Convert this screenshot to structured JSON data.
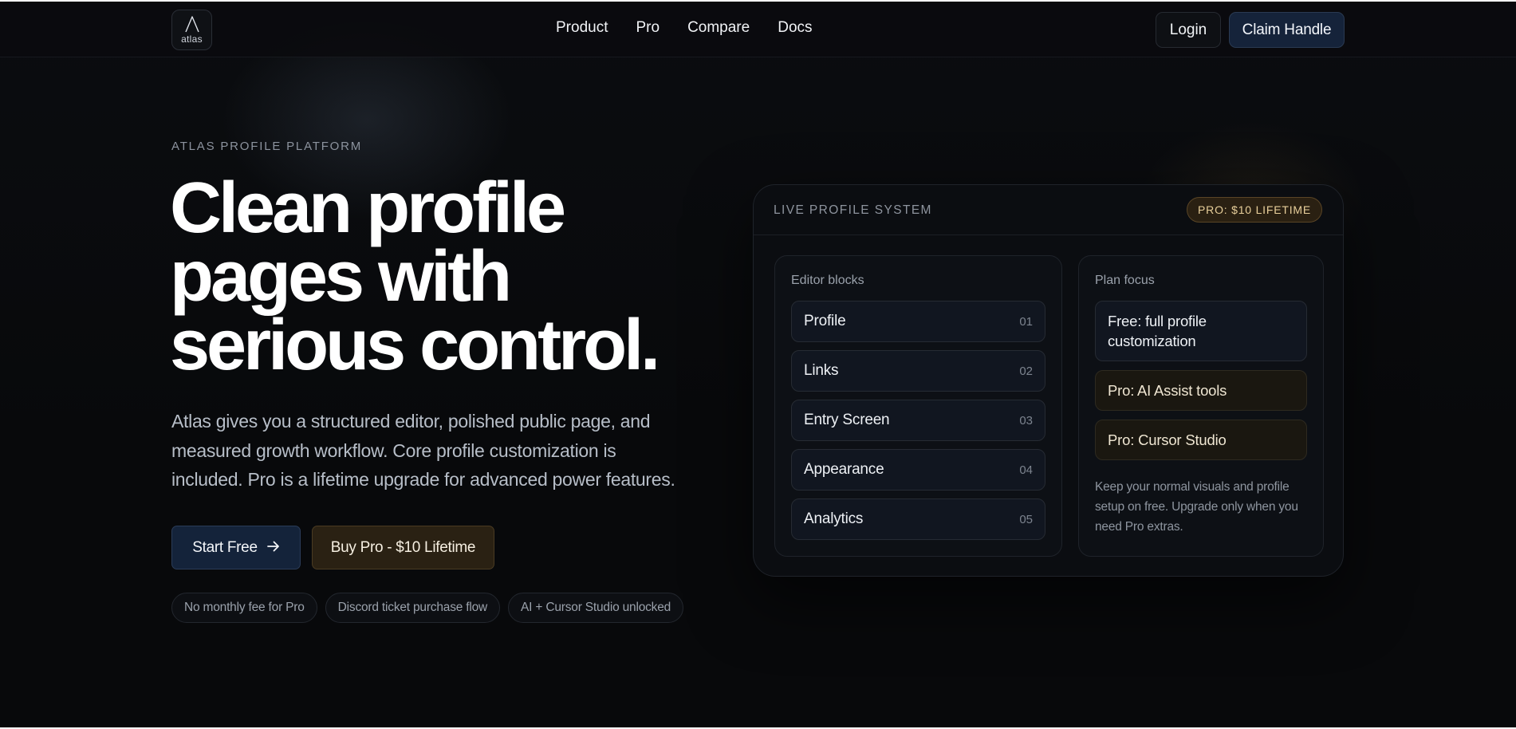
{
  "nav": {
    "logo_text": "atlas",
    "logo_icon": "atlas-a-logo-icon",
    "links": [
      "Product",
      "Pro",
      "Compare",
      "Docs"
    ],
    "login_label": "Login",
    "claim_label": "Claim Handle"
  },
  "hero": {
    "eyebrow": "ATLAS PROFILE PLATFORM",
    "headline_lines": [
      "Clean profile",
      "pages with",
      "serious control."
    ],
    "subcopy_lines": [
      "Atlas gives you a structured editor, polished public page, and",
      "measured growth workflow. Core profile customization is",
      "included. Pro is a lifetime upgrade for advanced power features."
    ],
    "start_label": "Start Free",
    "start_icon": "arrow-right-icon",
    "buy_label": "Buy Pro - $10 Lifetime",
    "pills": [
      "No monthly fee for Pro",
      "Discord ticket purchase flow",
      "AI + Cursor Studio unlocked"
    ]
  },
  "panel": {
    "title": "LIVE PROFILE SYSTEM",
    "badge": "PRO: $10 LIFETIME",
    "editor": {
      "label": "Editor blocks",
      "blocks": [
        {
          "name": "Profile",
          "num": "01"
        },
        {
          "name": "Links",
          "num": "02"
        },
        {
          "name": "Entry Screen",
          "num": "03"
        },
        {
          "name": "Appearance",
          "num": "04"
        },
        {
          "name": "Analytics",
          "num": "05"
        }
      ]
    },
    "plan": {
      "label": "Plan focus",
      "items": [
        {
          "text": "Free: full profile customization",
          "tier": "free"
        },
        {
          "text": "Pro: AI Assist tools",
          "tier": "pro"
        },
        {
          "text": "Pro: Cursor Studio",
          "tier": "pro"
        }
      ],
      "note": "Keep your normal visuals and profile setup on free. Upgrade only when you need Pro extras."
    }
  },
  "colors": {
    "background": "#08090b",
    "primary_button": "#14233a",
    "pro_accent": "#e8cf9b",
    "pro_button": "#2a2113"
  }
}
